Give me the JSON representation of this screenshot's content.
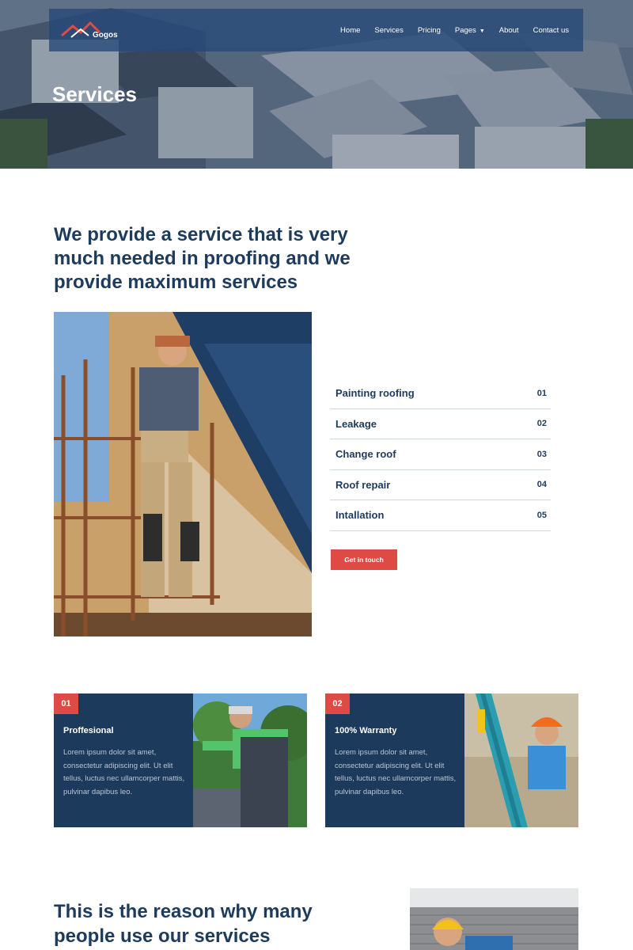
{
  "brand": {
    "name": "Gogos"
  },
  "nav": {
    "links": [
      "Home",
      "Services",
      "Pricing",
      "Pages",
      "About",
      "Contact us"
    ]
  },
  "hero": {
    "title": "Services"
  },
  "intro": {
    "heading": "We provide a service that is very much needed in proofing and we provide maximum services"
  },
  "services": [
    {
      "name": "Painting roofing",
      "num": "01"
    },
    {
      "name": "Leakage",
      "num": "02"
    },
    {
      "name": "Change roof",
      "num": "03"
    },
    {
      "name": "Roof repair",
      "num": "04"
    },
    {
      "name": "Intallation",
      "num": "05"
    }
  ],
  "cta": {
    "label": "Get in touch"
  },
  "features": [
    {
      "num": "01",
      "title": "Proffesional",
      "text": "Lorem ipsum dolor sit amet, consectetur adipiscing elit. Ut elit tellus, luctus nec ullamcorper mattis, pulvinar dapibus leo."
    },
    {
      "num": "02",
      "title": "100% Warranty",
      "text": "Lorem ipsum dolor sit amet, consectetur adipiscing elit. Ut elit tellus, luctus nec ullamcorper mattis, pulvinar dapibus leo."
    }
  ],
  "reason": {
    "heading": "This is the reason why many people use our services"
  },
  "colors": {
    "accent": "#de4a44",
    "navy": "#1c3a5b",
    "heading": "#1d3b5c"
  }
}
